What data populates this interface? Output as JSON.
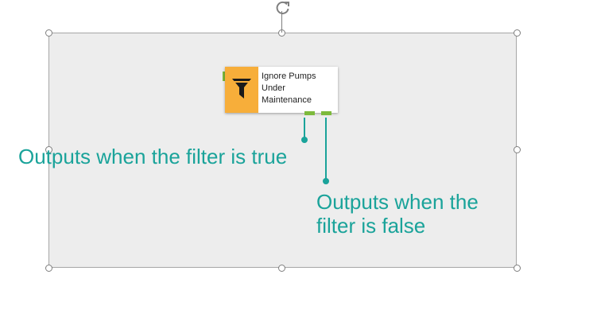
{
  "node": {
    "title_lines": [
      "Ignore Pumps",
      "Under",
      "Maintenance"
    ],
    "icon": "filter-funnel-icon",
    "icon_bg_color": "#f7ae3a",
    "anchor_color": "#7dba3c"
  },
  "annotations": {
    "true_output": "Outputs when the filter is true",
    "false_output_lines": [
      "Outputs when the",
      "filter is false"
    ],
    "color": "#1aa39a"
  }
}
